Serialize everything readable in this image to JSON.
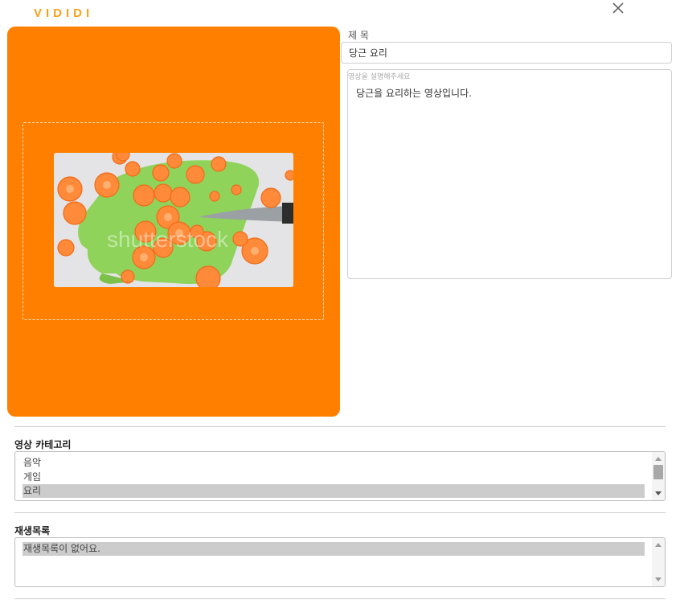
{
  "app": {
    "logo": "VIDIDI"
  },
  "header": {
    "close_icon": "close-icon"
  },
  "thumbnail": {
    "image": "carrots-on-cutting-board-photo",
    "panel_color": "#ff8000"
  },
  "title_field": {
    "label": "제 목",
    "value": "당근 요리"
  },
  "description": {
    "placeholder": "영상을 설명해주세요",
    "value": "당근을 요리하는 영상입니다."
  },
  "category": {
    "label": "영상 카테고리",
    "options": [
      "음악",
      "게임",
      "요리"
    ],
    "selected": "요리"
  },
  "playlist": {
    "label": "재생목록",
    "options": [
      "재생목록이 없어요."
    ],
    "selected": "재생목록이 없어요."
  },
  "colors": {
    "accent": "#f7a21a",
    "thumbnail_bg": "#ff8000",
    "selection": "#cccccc"
  }
}
